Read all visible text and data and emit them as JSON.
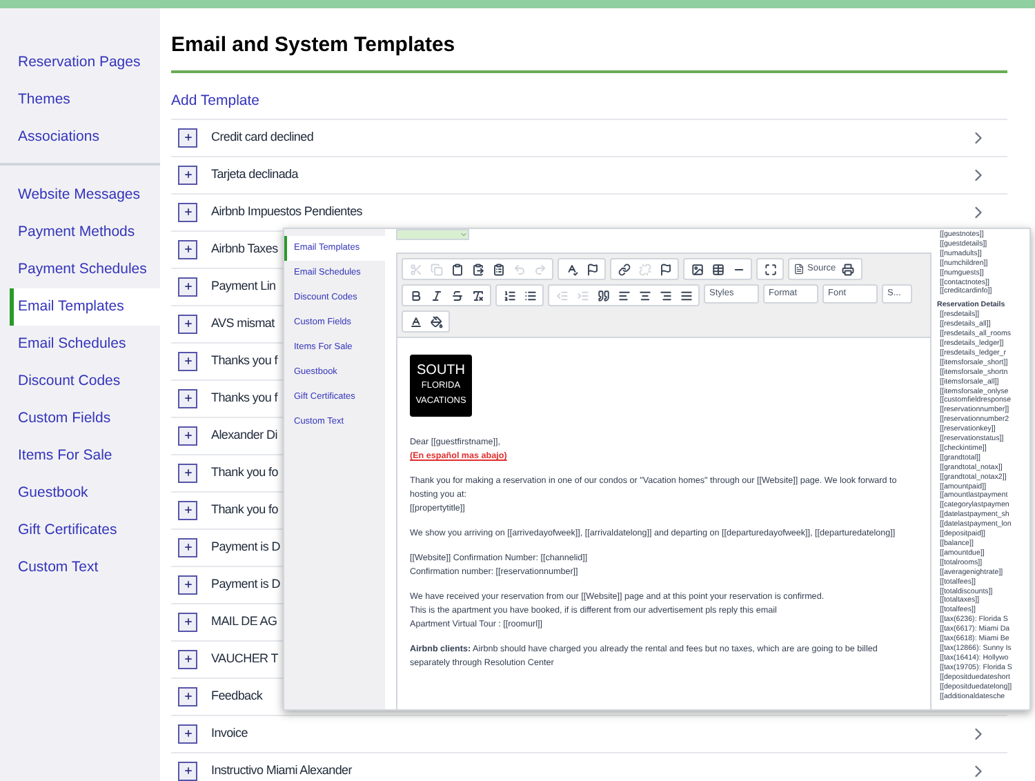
{
  "sidebar": {
    "groups": [
      [
        {
          "label": "Reservation Pages",
          "selected": false
        },
        {
          "label": "Themes",
          "selected": false
        },
        {
          "label": "Associations",
          "selected": false
        }
      ],
      [
        {
          "label": "Website Messages",
          "selected": false
        },
        {
          "label": "Payment Methods",
          "selected": false
        },
        {
          "label": "Payment Schedules",
          "selected": false
        },
        {
          "label": "Email Templates",
          "selected": true
        },
        {
          "label": "Email Schedules",
          "selected": false
        },
        {
          "label": "Discount Codes",
          "selected": false
        },
        {
          "label": "Custom Fields",
          "selected": false
        },
        {
          "label": "Items For Sale",
          "selected": false
        },
        {
          "label": "Guestbook",
          "selected": false
        },
        {
          "label": "Gift Certificates",
          "selected": false
        },
        {
          "label": "Custom Text",
          "selected": false
        }
      ]
    ]
  },
  "page": {
    "title": "Email and System Templates",
    "add_link": "Add Template"
  },
  "templates": [
    {
      "title": "Credit card declined",
      "arrow": true
    },
    {
      "title": "Tarjeta declinada",
      "arrow": true
    },
    {
      "title": "Airbnb Impuestos Pendientes",
      "arrow": true
    },
    {
      "title": "Airbnb Taxes",
      "arrow": false
    },
    {
      "title": "Payment Lin",
      "arrow": false
    },
    {
      "title": "AVS mismat",
      "arrow": false
    },
    {
      "title": "Thanks you f",
      "arrow": false
    },
    {
      "title": "Thanks you f",
      "arrow": false
    },
    {
      "title": "Alexander Di",
      "arrow": false
    },
    {
      "title": "Thank you fo",
      "arrow": false
    },
    {
      "title": "Thank you fo",
      "arrow": false
    },
    {
      "title": "Payment is D",
      "arrow": false
    },
    {
      "title": "Payment is D",
      "arrow": false
    },
    {
      "title": "MAIL DE AG",
      "arrow": false
    },
    {
      "title": "VAUCHER T",
      "arrow": false
    },
    {
      "title": "Feedback",
      "arrow": false
    },
    {
      "title": "Invoice",
      "arrow": true
    },
    {
      "title": "Instructivo Miami Alexander",
      "arrow": true
    }
  ],
  "overlay": {
    "nav": [
      {
        "label": "Email Templates",
        "selected": true
      },
      {
        "label": "Email Schedules",
        "selected": false
      },
      {
        "label": "Discount Codes",
        "selected": false
      },
      {
        "label": "Custom Fields",
        "selected": false
      },
      {
        "label": "Items For Sale",
        "selected": false
      },
      {
        "label": "Guestbook",
        "selected": false
      },
      {
        "label": "Gift Certificates",
        "selected": false
      },
      {
        "label": "Custom Text",
        "selected": false
      }
    ],
    "toolbar": {
      "source": "Source",
      "dropdowns": [
        "Styles",
        "Format",
        "Font",
        "S..."
      ]
    },
    "logo": [
      "SOUTH",
      "FLORIDA",
      "VACATIONS"
    ],
    "body": [
      [
        {
          "parts": [
            {
              "text": "Dear [[guestfirstname]],",
              "red": false
            }
          ]
        },
        {
          "parts": [
            {
              "text": "(En español mas abajo)",
              "red": true,
              "bold": true
            }
          ]
        }
      ],
      [
        {
          "parts": [
            {
              "text": "Thank you for making a reservation in one of our condos or \"Vacation homes\" through our [[Website]] page. We look forward to hosting you at:",
              "red": false
            }
          ]
        },
        {
          "parts": [
            {
              "text": "[[propertytitle]]",
              "red": false
            }
          ]
        }
      ],
      [
        {
          "parts": [
            {
              "text": "We show you arriving on [[arrivedayofweek]], [[arrivaldatelong]] and departing on [[departuredayofweek]], [[departuredatelong]]",
              "red": false
            }
          ]
        }
      ],
      [
        {
          "parts": [
            {
              "text": "[[Website]] Confirmation Number: [[channelid]]",
              "red": false
            }
          ]
        },
        {
          "parts": [
            {
              "text": "Confirmation number: [[reservationnumber]]",
              "red": false
            }
          ]
        }
      ],
      [
        {
          "parts": [
            {
              "text": "We have received your reservation from our [[Website]] page and at this point your reservation is confirmed.",
              "red": false
            }
          ]
        },
        {
          "parts": [
            {
              "text": "This is the apartment you have booked, if is different from our advertisement pls reply this email",
              "red": false
            }
          ]
        },
        {
          "parts": [
            {
              "text": "Apartment Virtual Tour : [[roomurl]]",
              "red": false
            }
          ]
        }
      ],
      [
        {
          "parts": [
            {
              "text": "**Airbnb clients:** Airbnb should have charged you already the rental and fees but no taxes, which are are going to be billed separately through Resolution Center",
              "red": false
            }
          ]
        }
      ]
    ],
    "variables_top": [
      "[[guestnotes]]",
      "[[guestdetails]]",
      "[[numadults]]",
      "[[numchildren]]",
      "[[numguests]]",
      "[[contactnotes]]",
      "[[creditcardinfo]]"
    ],
    "variables_heading": "Reservation Details",
    "variables": [
      "[[resdetails]]",
      "[[resdetails_all]]",
      "[[resdetails_all_rooms",
      "[[resdetails_ledger]]",
      "[[resdetails_ledger_r",
      "[[itemsforsale_short]]",
      "[[itemsforsale_shortn",
      "[[itemsforsale_all]]",
      "[[itemsforsale_onlyse",
      "[[customfieldresponse",
      "[[reservationnumber]]",
      "[[reservationnumber2",
      "[[reservationkey]]",
      "[[reservationstatus]]",
      "[[checkintime]]",
      "[[grandtotal]]",
      "[[grandtotal_notax]]",
      "[[grandtotal_notax2]]",
      "[[amountpaid]]",
      "[[amountlastpayment",
      "[[categorylastpaymen",
      "[[datelastpayment_sh",
      "[[datelastpayment_lon",
      "[[depositpaid]]",
      "[[balance]]",
      "[[amountdue]]",
      "[[totalrooms]]",
      "[[averagenightrate]]",
      "[[totalfees]]",
      "[[totaldiscounts]]",
      "[[totaltaxes]]",
      "[[totalfees]]",
      "[[tax(6236): Florida S",
      "[[tax(6617): Miami Da",
      "[[tax(6618): Miami Be",
      "[[tax(12866): Sunny Is",
      "[[tax(16414): Hollywo",
      "[[tax(19705): Florida S",
      "[[depositduedateshort",
      "[[depositduedatelong]]",
      "[[additionaldatesche"
    ]
  }
}
